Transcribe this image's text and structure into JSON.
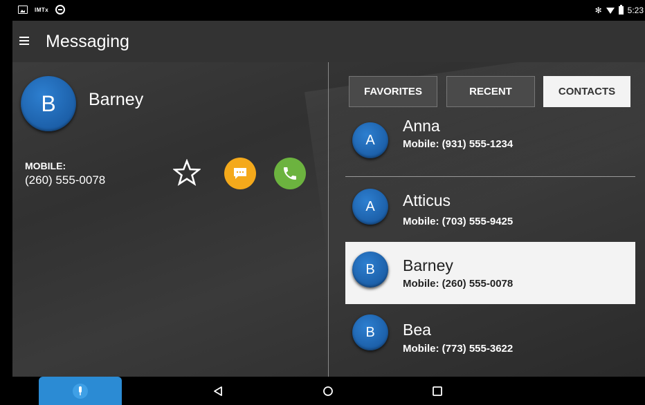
{
  "status_bar": {
    "left_text": "IMTx",
    "time": "5:23"
  },
  "app_bar": {
    "title": "Messaging"
  },
  "detail": {
    "initial": "B",
    "name": "Barney",
    "phone_label": "MOBILE:",
    "phone_number": "(260) 555-0078"
  },
  "tabs": [
    {
      "label": "FAVORITES",
      "active": false
    },
    {
      "label": "RECENT",
      "active": false
    },
    {
      "label": "CONTACTS",
      "active": true
    }
  ],
  "contacts": [
    {
      "initial": "A",
      "name": "Anna",
      "phone": "Mobile:  (931) 555-1234",
      "selected": false
    },
    {
      "initial": "A",
      "name": "Atticus",
      "phone": "Mobile:  (703) 555-9425",
      "selected": false
    },
    {
      "initial": "B",
      "name": "Barney",
      "phone": "Mobile:  (260) 555-0078",
      "selected": true
    },
    {
      "initial": "B",
      "name": "Bea",
      "phone": "Mobile:  (773) 555-3622",
      "selected": false
    }
  ],
  "colors": {
    "avatar_blue": "#1c5fa8",
    "message_orange": "#f4a91b",
    "call_green": "#6cb33f",
    "mic_blue": "#2b8bd4"
  },
  "icons": {
    "menu": "menu-icon",
    "favorite": "star-outline-icon",
    "message": "message-icon",
    "call": "phone-icon",
    "mic": "microphone-icon",
    "back": "back-icon",
    "home": "home-icon",
    "recent": "recent-apps-icon"
  }
}
